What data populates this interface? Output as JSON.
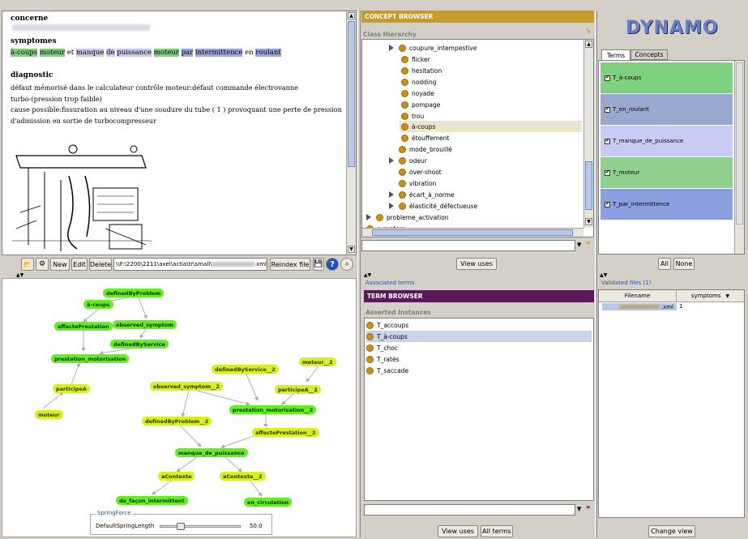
{
  "document": {
    "concerne_heading": "concerne",
    "symptomes_heading": "symptomes",
    "symptom_words": [
      "à-coups",
      "moteur",
      "et",
      "manque",
      "de",
      "puissance",
      "moteur",
      "par",
      "intermittence",
      "en",
      "roulant"
    ],
    "diagnostic_heading": "diagnostic",
    "diagnostic_lines": [
      "défaut mémorisé dans le calculateur contrôle moteur:défaut commande électrovanne",
      "turbo-(pression trop faible)",
      "cause possible:fissuration au niveau d'une soudure du tube ( 1 ) provoquant une perte de pression",
      "d'admission en sortie de turbocompresseur"
    ]
  },
  "doc_toolbar": {
    "new": "New",
    "edit": "Edit",
    "delete": "Delete",
    "path": "\\\\F:\\2200\\2211\\axel\\actia\\tr\\small\\",
    "path_ext": ".xml",
    "reindex": "Reindex file"
  },
  "graph": {
    "nodes": {
      "n1": "definedByProblem",
      "n2": "à-coups",
      "n3": "affectePrestation",
      "n4": "observed_symptom",
      "n5": "definedByService",
      "n6": "prestation_motorisation",
      "n7": "participeA",
      "n8": "moteur",
      "n9": "definedByService__2",
      "n10": "moteur__2",
      "n11": "observed_symptom__2",
      "n12": "participeA__2",
      "n13": "prestation_motorisation__2",
      "n14": "definedByProblem__2",
      "n15": "affectePrestation__2",
      "n16": "manque_de_puissance",
      "n17": "aContexte",
      "n18": "aContexte__2",
      "n19": "de_façon_intermittent",
      "n20": "en_circulation"
    },
    "spring": {
      "title": "SpringForce",
      "label": "DefaultSpringLength",
      "value": "50.0",
      "level_fraction": 0.25
    }
  },
  "concept_browser": {
    "title": "CONCEPT BROWSER",
    "section": "Class Hierarchy",
    "items": [
      "coupure_intempestive",
      "flicker",
      "hesitation",
      "nodding",
      "noyade",
      "pompage",
      "trou",
      "à-coups",
      "étouffement",
      "mode_brouillé",
      "odeur",
      "over-shoot",
      "vibration",
      "écart_à_norme",
      "élasticité_défectueuse",
      "probleme_activation",
      "symptom"
    ],
    "view_uses": "View uses"
  },
  "term_browser": {
    "associated": "Associated terms",
    "title": "TERM BROWSER",
    "section": "Asserted Instances",
    "items": [
      "T_accoups",
      "T_à-coups",
      "T_choc",
      "T_ratés",
      "T_saccade"
    ],
    "view_uses": "View uses",
    "all_terms": "All terms"
  },
  "right": {
    "logo": "DYNAMO",
    "tab_terms": "Terms",
    "tab_concepts": "Concepts",
    "validated": [
      "T_à-coups",
      "T_en_roulant",
      "T_manque_de_puissance",
      "T_moteur",
      "T_par_intermittence"
    ],
    "row_colors": [
      "#7fd07f",
      "#9aa8d0",
      "#c8ccf4",
      "#8fd08f",
      "#8a9fe0"
    ],
    "all": "All",
    "none": "None",
    "validated_files": "Validated files (1)",
    "col_filename": "Filename",
    "col_symptoms": "symptoms",
    "file_ext": ".xml",
    "file_count": "1",
    "change_view": "Change view"
  }
}
